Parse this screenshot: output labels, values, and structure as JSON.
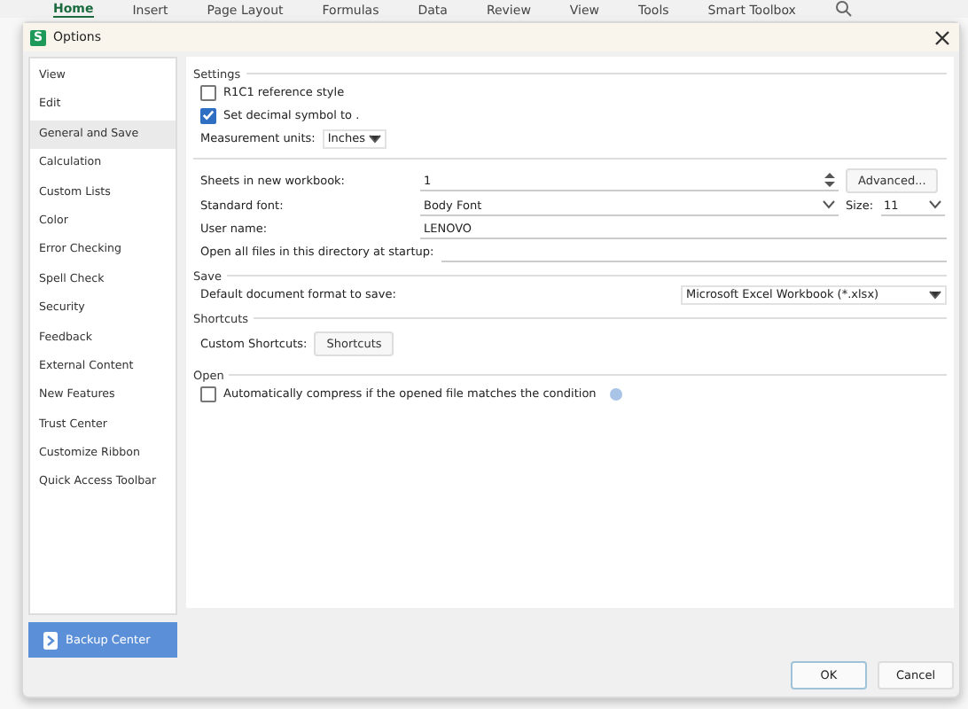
{
  "ribbon_tabs": [
    {
      "label": "Home",
      "selected": true
    },
    {
      "label": "Insert",
      "selected": false
    },
    {
      "label": "Page Layout",
      "selected": false
    },
    {
      "label": "Formulas",
      "selected": false
    },
    {
      "label": "Data",
      "selected": false
    },
    {
      "label": "Review",
      "selected": false
    },
    {
      "label": "View",
      "selected": false
    },
    {
      "label": "Tools",
      "selected": false
    },
    {
      "label": "Smart Toolbox",
      "selected": false
    }
  ],
  "dialog": {
    "title": "Options",
    "app_badge": "S"
  },
  "sidebar": {
    "items": [
      {
        "label": "View",
        "selected": false
      },
      {
        "label": "Edit",
        "selected": false
      },
      {
        "label": "General and Save",
        "selected": true
      },
      {
        "label": "Calculation",
        "selected": false
      },
      {
        "label": "Custom Lists",
        "selected": false
      },
      {
        "label": "Color",
        "selected": false
      },
      {
        "label": "Error Checking",
        "selected": false
      },
      {
        "label": "Spell Check",
        "selected": false
      },
      {
        "label": "Security",
        "selected": false
      },
      {
        "label": "Feedback",
        "selected": false
      },
      {
        "label": "External Content",
        "selected": false
      },
      {
        "label": "New Features",
        "selected": false
      },
      {
        "label": "Trust Center",
        "selected": false
      },
      {
        "label": "Customize Ribbon",
        "selected": false
      },
      {
        "label": "Quick Access Toolbar",
        "selected": false
      }
    ],
    "backup_button": "Backup Center"
  },
  "settings": {
    "title": "Settings",
    "checkboxes": [
      {
        "label": "R1C1 reference style",
        "checked": false
      },
      {
        "label": "Set decimal symbol to .",
        "checked": true
      }
    ],
    "measurement": {
      "label": "Measurement units:",
      "value": "Inches"
    }
  },
  "general": {
    "sheets": {
      "label": "Sheets in new workbook:",
      "value": "1"
    },
    "advanced_button": "Advanced...",
    "font": {
      "label": "Standard font:",
      "value": "Body Font"
    },
    "size": {
      "label": "Size:",
      "value": "11"
    },
    "user_name": {
      "label": "User name:",
      "value": "LENOVO"
    },
    "startup_dir": {
      "label": "Open all files in this directory at startup:"
    }
  },
  "save": {
    "title": "Save",
    "label": "Default document format to save:",
    "value": "Microsoft Excel Workbook (*.xlsx)"
  },
  "shortcuts": {
    "title": "Shortcuts",
    "label": "Custom Shortcuts:",
    "button": "Shortcuts"
  },
  "open": {
    "title": "Open",
    "checkbox": {
      "label": "Automatically compress if the opened file matches the condition",
      "checked": false
    }
  },
  "buttons": [
    {
      "label": "OK",
      "selected": true
    },
    {
      "label": "Cancel",
      "selected": false
    }
  ]
}
